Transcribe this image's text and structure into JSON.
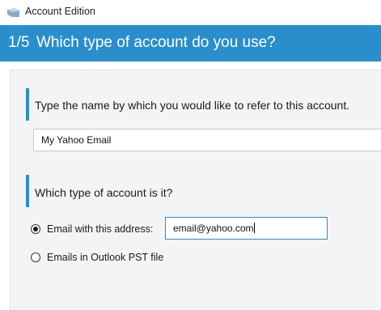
{
  "window": {
    "title": "Account Edition",
    "icon": "envelope-icon"
  },
  "header": {
    "step": "1/5",
    "question": "Which type of account do you use?"
  },
  "name_section": {
    "label": "Type the name by which you would like to refer to this account.",
    "value": "My Yahoo Email"
  },
  "type_section": {
    "label": "Which type of account is it?",
    "options": [
      {
        "label": "Email with this address:",
        "selected": true
      },
      {
        "label": "Emails in Outlook PST file",
        "selected": false
      }
    ],
    "email_value": "email@yahoo.com"
  },
  "colors": {
    "accent": "#2a8ecd",
    "panel": "#f4f4f4"
  }
}
